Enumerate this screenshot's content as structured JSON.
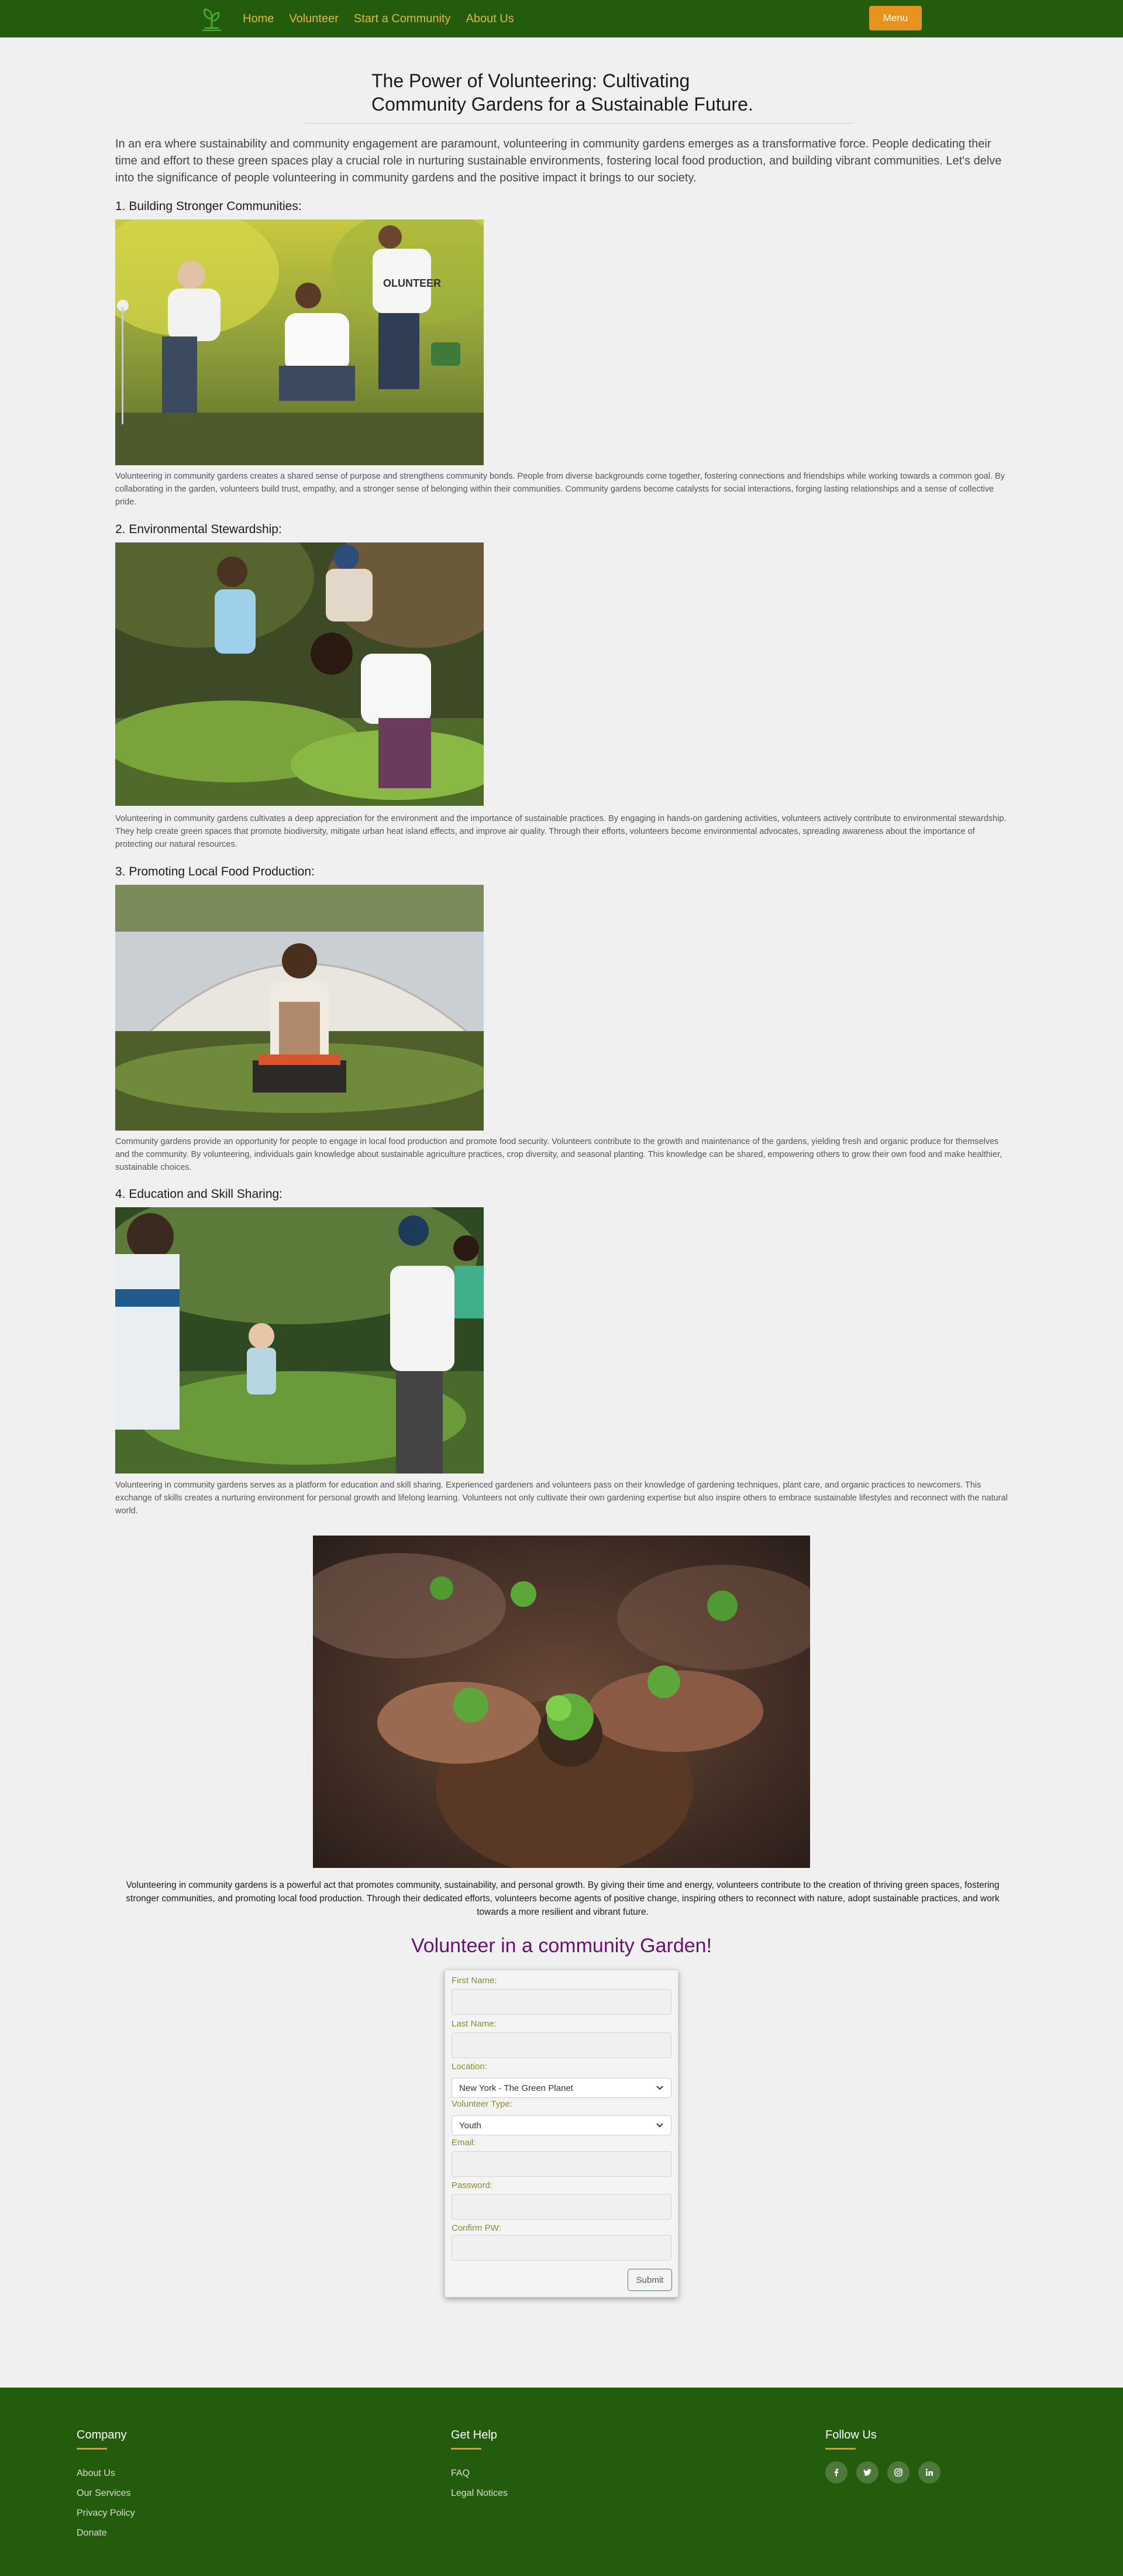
{
  "nav": {
    "links": [
      "Home",
      "Volunteer",
      "Start a Community",
      "About Us"
    ],
    "menu_label": "Menu"
  },
  "article": {
    "title": "The Power of Volunteering: Cultivating Community Gardens for a Sustainable Future.",
    "intro": "In an era where sustainability and community engagement are paramount, volunteering in community gardens emerges as a transformative force. People dedicating their time and effort to these green spaces play a crucial role in nurturing sustainable environments, fostering local food production, and building vibrant communities. Let's delve into the significance of people volunteering in community gardens and the positive impact it brings to our society.",
    "sections": [
      {
        "heading": "1. Building Stronger Communities:",
        "text": "Volunteering in community gardens creates a shared sense of purpose and strengthens community bonds. People from diverse backgrounds come together, fostering connections and friendships while working towards a common goal. By collaborating in the garden, volunteers build trust, empathy, and a stronger sense of belonging within their communities. Community gardens become catalysts for social interactions, forging lasting relationships and a sense of collective pride.",
        "image_shirt_text": "OLUNTEER"
      },
      {
        "heading": "2. Environmental Stewardship:",
        "text": "Volunteering in community gardens cultivates a deep appreciation for the environment and the importance of sustainable practices. By engaging in hands-on gardening activities, volunteers actively contribute to environmental stewardship. They help create green spaces that promote biodiversity, mitigate urban heat island effects, and improve air quality. Through their efforts, volunteers become environmental advocates, spreading awareness about the importance of protecting our natural resources."
      },
      {
        "heading": "3. Promoting Local Food Production:",
        "text": "Community gardens provide an opportunity for people to engage in local food production and promote food security. Volunteers contribute to the growth and maintenance of the gardens, yielding fresh and organic produce for themselves and the community. By volunteering, individuals gain knowledge about sustainable agriculture practices, crop diversity, and seasonal planting. This knowledge can be shared, empowering others to grow their own food and make healthier, sustainable choices."
      },
      {
        "heading": "4. Education and Skill Sharing:",
        "text": "Volunteering in community gardens serves as a platform for education and skill sharing. Experienced gardeners and volunteers pass on their knowledge of gardening techniques, plant care, and organic practices to newcomers. This exchange of skills creates a nurturing environment for personal growth and lifelong learning. Volunteers not only cultivate their own gardening expertise but also inspire others to embrace sustainable lifestyles and reconnect with the natural world."
      }
    ],
    "conclusion": "Volunteering in community gardens is a powerful act that promotes community, sustainability, and personal growth. By giving their time and energy, volunteers contribute to the creation of thriving green spaces, fostering stronger communities, and promoting local food production. Through their dedicated efforts, volunteers become agents of positive change, inspiring others to reconnect with nature, adopt sustainable practices, and work towards a more resilient and vibrant future."
  },
  "form": {
    "title": "Volunteer in a community Garden!",
    "first_name_label": "First Name:",
    "last_name_label": "Last Name:",
    "location_label": "Location:",
    "location_value": "New York - The Green Planet",
    "volunteer_type_label": "Volunteer Type:",
    "volunteer_type_value": "Youth",
    "email_label": "Email:",
    "password_label": "Password:",
    "confirm_label": "Confirm PW:",
    "submit_label": "Submit"
  },
  "footer": {
    "company_heading": "Company",
    "company_links": [
      "About Us",
      "Our Services",
      "Privacy Policy",
      "Donate"
    ],
    "help_heading": "Get Help",
    "help_links": [
      "FAQ",
      "Legal Notices"
    ],
    "follow_heading": "Follow Us",
    "social_icons": [
      "facebook-icon",
      "twitter-icon",
      "instagram-icon",
      "linkedin-icon"
    ]
  },
  "colors": {
    "nav_bg": "#225c0c",
    "nav_link": "#e6b53a",
    "accent_orange": "#e8921f",
    "form_title": "#6b0f74",
    "form_label": "#8a8a2e"
  }
}
